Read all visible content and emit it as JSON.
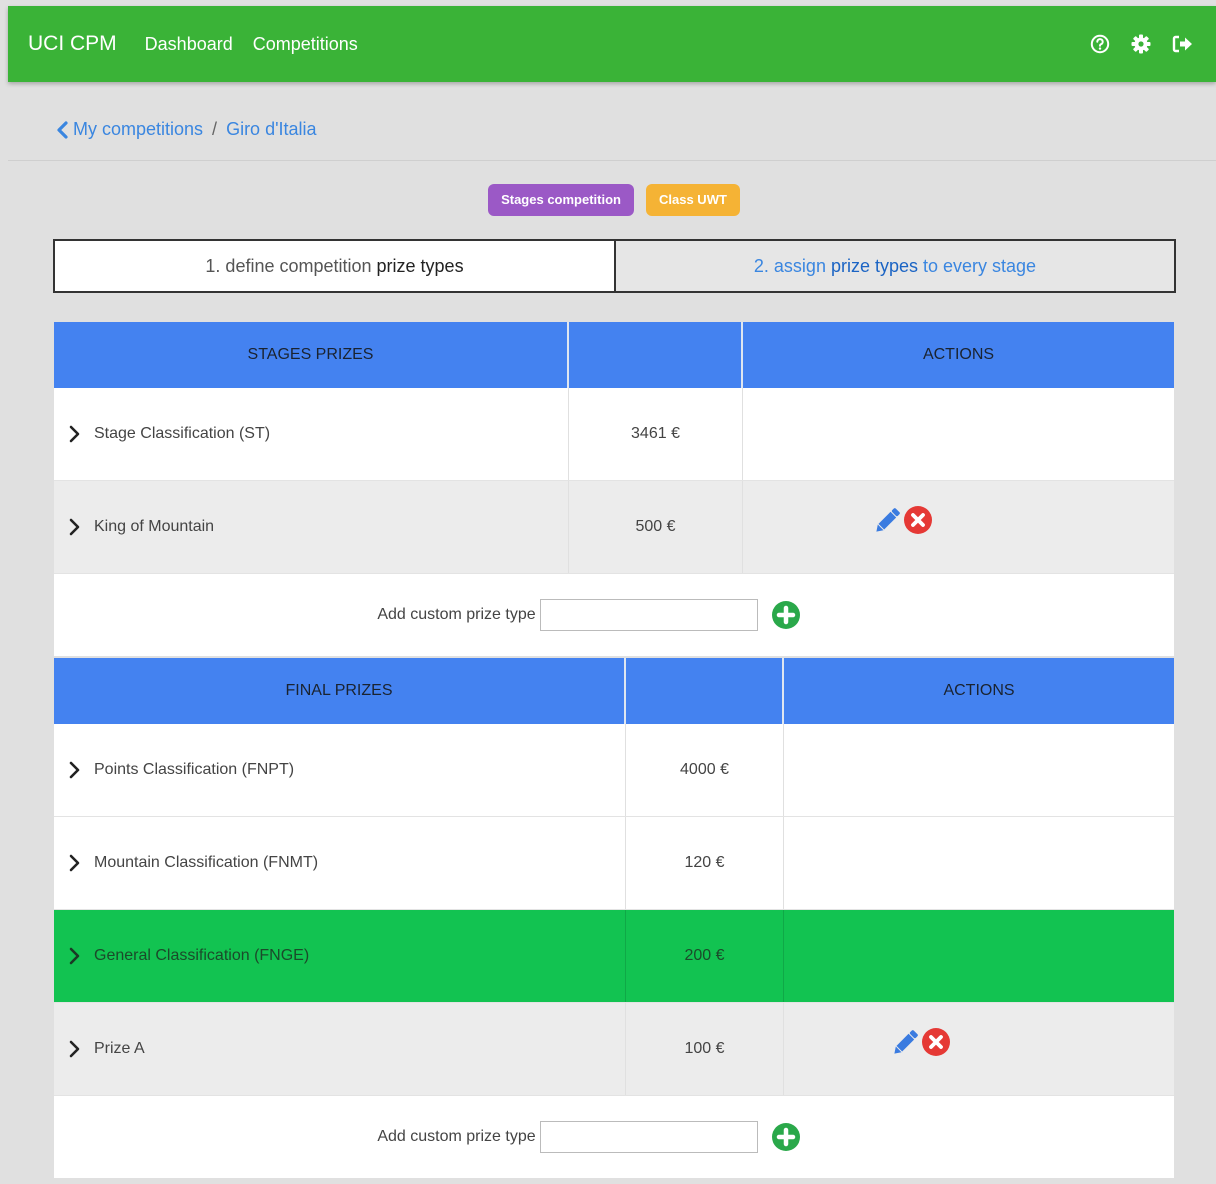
{
  "navbar": {
    "brand": "UCI CPM",
    "links": [
      "Dashboard",
      "Competitions"
    ],
    "icons": [
      "help-icon",
      "settings-icon",
      "logout-icon"
    ],
    "color": "#3ab337"
  },
  "breadcrumb": {
    "back": "My competitions",
    "separator": "/",
    "current": "Giro d'Italia"
  },
  "badges": {
    "type": "Stages competition",
    "class": "Class UWT"
  },
  "steps": {
    "step1_prefix": "1. define competition ",
    "step1_bold": "prize types",
    "step2_prefix": "2. assign ",
    "step2_bold": "prize types",
    "step2_suffix": " to every stage"
  },
  "stages_table": {
    "headers": [
      "STAGES PRIZES",
      "",
      "ACTIONS"
    ],
    "rows": [
      {
        "name": "Stage Classification (ST)",
        "amount": "3461 €"
      },
      {
        "name": "King of Mountain",
        "amount": "500 €"
      }
    ],
    "add_label": "Add custom prize type",
    "add_value": ""
  },
  "final_table": {
    "headers": [
      "FINAL PRIZES",
      "",
      "ACTIONS"
    ],
    "rows": [
      {
        "name": "Points Classification (FNPT)",
        "amount": "4000 €"
      },
      {
        "name": "Mountain Classification (FNMT)",
        "amount": "120 €"
      },
      {
        "name": "General Classification (FNGE)",
        "amount": "200 €"
      },
      {
        "name": "Prize A",
        "amount": "100 €"
      }
    ],
    "add_label": "Add custom prize type",
    "add_value": ""
  },
  "colors": {
    "header_blue": "#4482f0",
    "highlight_green": "#12c351",
    "edit_blue": "#3a7be0",
    "delete_red": "#e53935",
    "add_green": "#2aa84a"
  }
}
